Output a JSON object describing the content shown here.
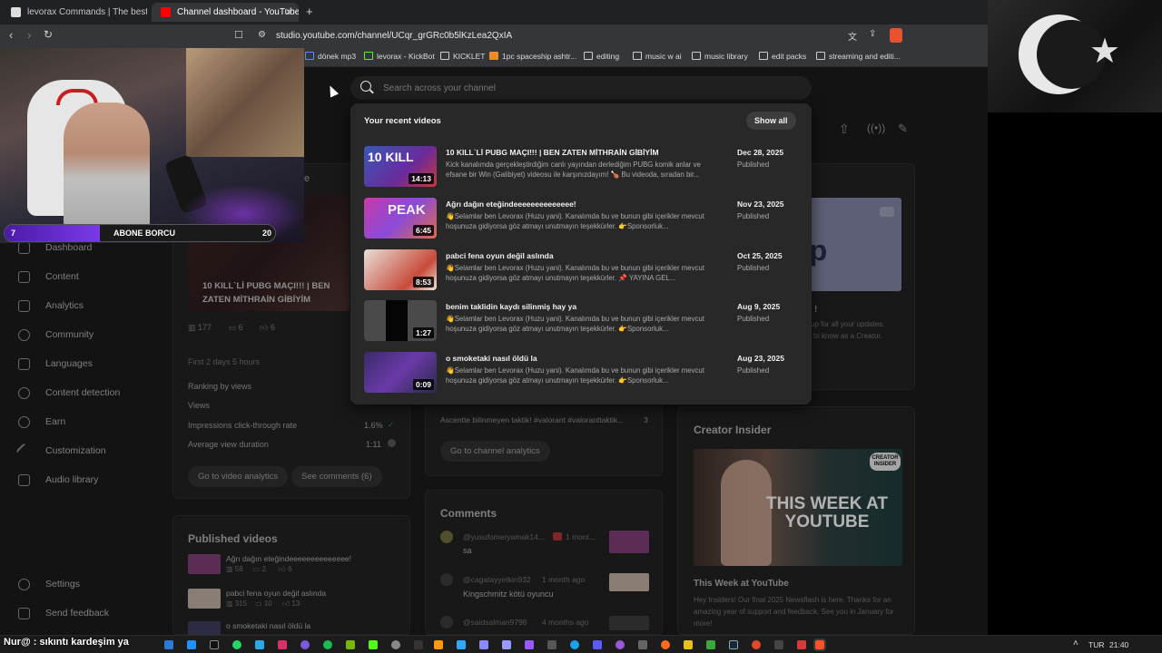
{
  "tabs": [
    {
      "label": "levorax Commands | The best ChatBo",
      "active": false
    },
    {
      "label": "Channel dashboard - YouTube Studio",
      "active": true
    }
  ],
  "address": {
    "url": "studio.youtube.com/channel/UCqr_grGRc0b5lKzLea2QxIA"
  },
  "bookmarks": [
    "dönek mp3",
    "levorax - KickBot",
    "KICKLET",
    "1pc spaceship ashtr...",
    "editing",
    "music w ai",
    "music library",
    "edit packs",
    "streaming and editi..."
  ],
  "webcam": {
    "overlay_left": "7",
    "overlay_label": "ABONE BORCU",
    "overlay_right": "20"
  },
  "sidebar": {
    "items": [
      "Dashboard",
      "Content",
      "Analytics",
      "Community",
      "Languages",
      "Content detection",
      "Earn",
      "Customization",
      "Audio library"
    ],
    "bottom": [
      "Settings",
      "Send feedback"
    ]
  },
  "search": {
    "placeholder": "Search across your channel"
  },
  "dropdown": {
    "heading": "Your recent videos",
    "show_all": "Show all",
    "videos": [
      {
        "title": "10 KILL`Lİ PUBG MAÇI!!! | BEN ZATEN MİTHRAİN GİBİYİM",
        "desc": "Kick kanalımda gerçekleştirdiğim canlı yayından derlediğim PUBG komik anlar ve efsane bir Win (Galibiyet) videosu ile karşınızdayım! 🍗 Bu videoda, sıradan bir...",
        "date": "Dec 28, 2025",
        "status": "Published",
        "duration": "14:13"
      },
      {
        "title": "Ağrı dağın eteğindeeeeeeeeeeeeee!",
        "desc": "👋Selamlar ben Levorax (Huzu yani). Kanalımda bu ve bunun gibi içerikler mevcut hoşunuza gidiyorsa göz atmayı unutmayın teşekkürler. 👉Sponsorluk...",
        "date": "Nov 23, 2025",
        "status": "Published",
        "duration": "6:45"
      },
      {
        "title": "pabci fena oyun değil aslında",
        "desc": "👋Selamlar ben Levorax (Huzu yani). Kanalımda bu ve bunun gibi içerikler mevcut hoşunuza gidiyorsa göz atmayı unutmayın teşekkürler. 📌 YAYINA GEL...",
        "date": "Oct 25, 2025",
        "status": "Published",
        "duration": "8:53"
      },
      {
        "title": "benim taklidin kaydı silinmiş hay ya",
        "desc": "👋Selamlar ben Levorax (Huzu yani). Kanalımda bu ve bunun gibi içerikler mevcut hoşunuza gidiyorsa göz atmayı unutmayın teşekkürler. 👉Sponsorluk...",
        "date": "Aug 9, 2025",
        "status": "Published",
        "duration": "1:27"
      },
      {
        "title": "o smoketaki nasıl öldü la",
        "desc": "👋Selamlar ben Levorax (Huzu yani). Kanalımda bu ve bunun gibi içerikler mevcut hoşunuza gidiyorsa göz atmayı unutmayın teşekkürler. 👉Sponsorluk...",
        "date": "Aug 23, 2025",
        "status": "Published",
        "duration": "0:09"
      }
    ]
  },
  "latest_video": {
    "title_fragment": "e",
    "title": "10 KILL`Lİ PUBG MAÇI!!! | BEN ZATEN MİTHRAİN GİBİYİM",
    "stats": [
      "177",
      "6",
      "6"
    ],
    "period": "First 2 days 5 hours",
    "ranking": "Ranking by views",
    "rows": [
      {
        "label": "Views",
        "value": ""
      },
      {
        "label": "Impressions click-through rate",
        "value": "1.6%"
      },
      {
        "label": "Average view duration",
        "value": "1:11"
      }
    ],
    "btn_analytics": "Go to video analytics",
    "btn_comments": "See comments (6)"
  },
  "analytics_card": {
    "row_text": "Ascentte bilinmeyen taktik! #valorant #valoranttaktik...",
    "row_value": "3",
    "button": "Go to channel analytics"
  },
  "published": {
    "title": "Published videos",
    "items": [
      {
        "title": "Ağrı dağın eteğindeeeeeeeeeeeeee!",
        "views": "58",
        "comments": "2",
        "likes": "6"
      },
      {
        "title": "pabci fena oyun değil aslında",
        "views": "315",
        "comments": "10",
        "likes": "13"
      },
      {
        "title": "o smoketaki nasıl öldü la",
        "views": "",
        "comments": "",
        "likes": ""
      }
    ]
  },
  "comments": {
    "title": "Comments",
    "items": [
      {
        "author": "@yusufomeryamak14...",
        "time": "1 mont...",
        "text": "sa"
      },
      {
        "author": "@cagatayyetkin932",
        "time": "1 month ago",
        "text": "Kingschmitz kötü oyuncu"
      },
      {
        "author": "@saidsalman9798",
        "time": "4 months ago",
        "text": ""
      }
    ]
  },
  "promo": {
    "big": "dUp",
    "lines": [
      "!",
      "up for all your updates.",
      "ed to know as a Creator."
    ]
  },
  "creator_insider": {
    "title": "Creator Insider",
    "badge": "CREATOR INSIDER",
    "thumb_text": "THIS WEEK AT YOUTUBE",
    "video_title": "This Week at YouTube",
    "desc": "Hey Insiders! Our final 2025 Newsflash is here. Thanks for an amazing year of support and feedback. See you in January for more!"
  },
  "chat_overlay": {
    "text": "Nur@ : sıkıntı kardeşim ya"
  },
  "taskbar": {
    "lang": "TUR",
    "time": "21:40"
  },
  "colors": {
    "studio_bg": "#1a1a1a",
    "card_bg": "#212121",
    "dropdown_bg": "#282828",
    "accent_red": "#ff0000",
    "webcam_bar": "#6b2fd6"
  }
}
